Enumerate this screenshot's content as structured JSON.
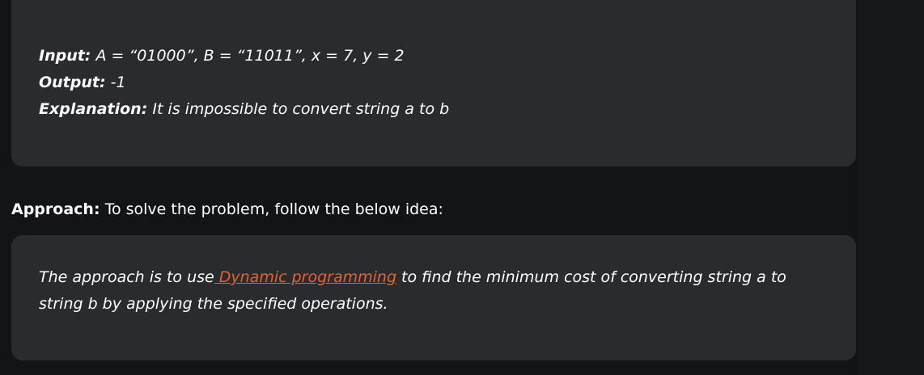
{
  "example": {
    "input_label": "Input:",
    "input_value": " A = “01000”, B = “11011”, x = 7, y = 2",
    "output_label": "Output:",
    "output_value": " -1",
    "explanation_label": "Explanation:",
    "explanation_value": " It is impossible to convert string a to b"
  },
  "approach": {
    "heading_label": "Approach:",
    "heading_text": " To solve the problem, follow the below idea:",
    "text_before_link": "The approach is to use",
    "link_text": " Dynamic programming",
    "text_after_link": " to find the minimum cost of converting string a to string b by applying the specified operations."
  },
  "colors": {
    "background": "#131417",
    "card": "#2a2b2e",
    "link": "#e1642c",
    "text": "#ffffff"
  }
}
